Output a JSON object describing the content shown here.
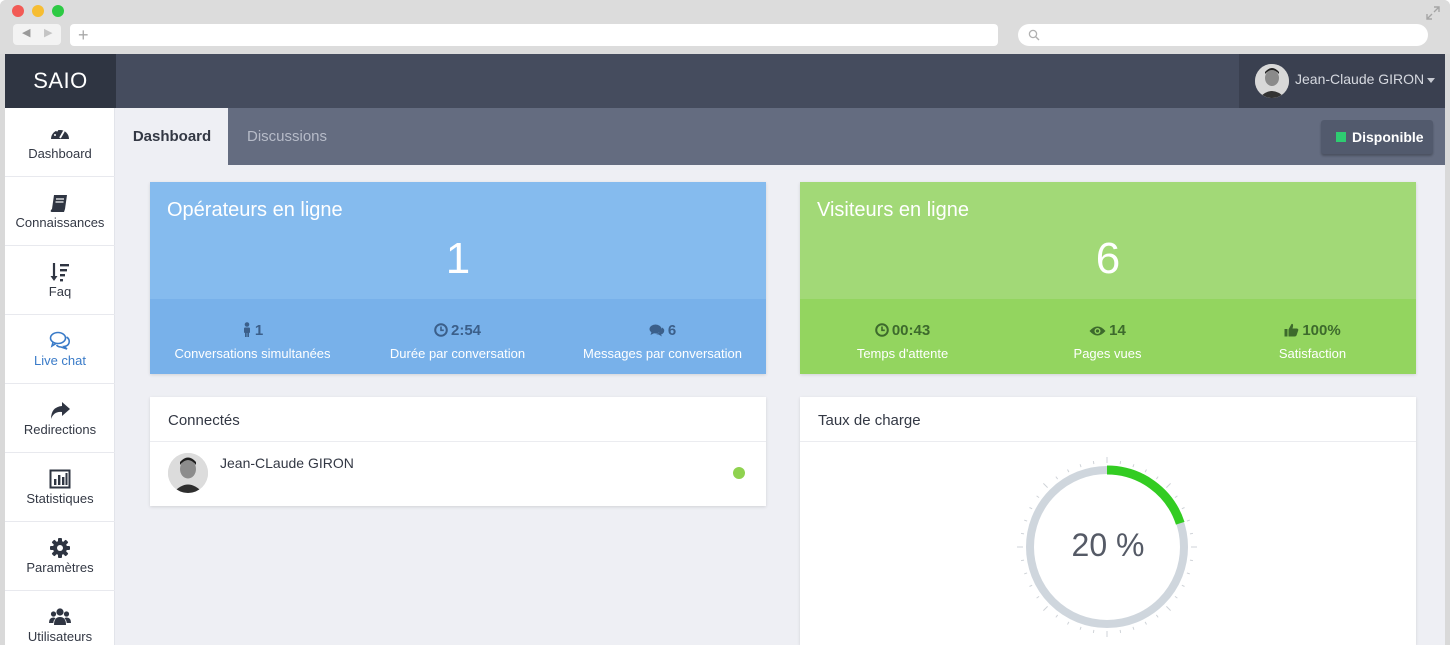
{
  "browser": {
    "back_glyph": "◀",
    "forward_glyph": "▶",
    "new_tab_glyph": "+"
  },
  "app": {
    "brand": "SAIO",
    "user": {
      "name": "Jean-Claude GIRON"
    }
  },
  "sidebar": {
    "items": [
      {
        "label": "Dashboard",
        "icon": "dashboard-icon"
      },
      {
        "label": "Connaissances",
        "icon": "book-icon"
      },
      {
        "label": "Faq",
        "icon": "sort-icon"
      },
      {
        "label": "Live chat",
        "icon": "chat-icon",
        "active": true
      },
      {
        "label": "Redirections",
        "icon": "share-icon"
      },
      {
        "label": "Statistiques",
        "icon": "bar-chart-icon"
      },
      {
        "label": "Paramètres",
        "icon": "gear-icon"
      },
      {
        "label": "Utilisateurs",
        "icon": "users-icon"
      }
    ]
  },
  "tabs": [
    {
      "label": "Dashboard",
      "active": true
    },
    {
      "label": "Discussions",
      "active": false
    }
  ],
  "status": {
    "label": "Disponible",
    "color": "#2ecc71"
  },
  "operators": {
    "title": "Opérateurs en ligne",
    "count": "1",
    "metrics": [
      {
        "value": "1",
        "label": "Conversations simultanées",
        "icon": "person-icon"
      },
      {
        "value": "2:54",
        "label": "Durée par conversation",
        "icon": "clock-icon"
      },
      {
        "value": "6",
        "label": "Messages par conversation",
        "icon": "comments-icon"
      }
    ]
  },
  "visitors": {
    "title": "Visiteurs en ligne",
    "count": "6",
    "metrics": [
      {
        "value": "00:43",
        "label": "Temps d'attente",
        "icon": "clock-icon"
      },
      {
        "value": "14",
        "label": "Pages vues",
        "icon": "eye-icon"
      },
      {
        "value": "100%",
        "label": "Satisfaction",
        "icon": "thumbs-up-icon"
      }
    ]
  },
  "connected": {
    "title": "Connectés",
    "users": [
      {
        "name": "Jean-CLaude GIRON",
        "status": "online"
      }
    ]
  },
  "charge": {
    "title": "Taux de charge",
    "value": 20,
    "label": "20 %"
  },
  "colors": {
    "operators_card": "#85bbee",
    "visitors_card": "#a2d977",
    "topbar": "#454c5e",
    "tabbar": "#646c80",
    "gauge_fill": "#33cc22",
    "gauge_track": "#cfd6dd"
  }
}
